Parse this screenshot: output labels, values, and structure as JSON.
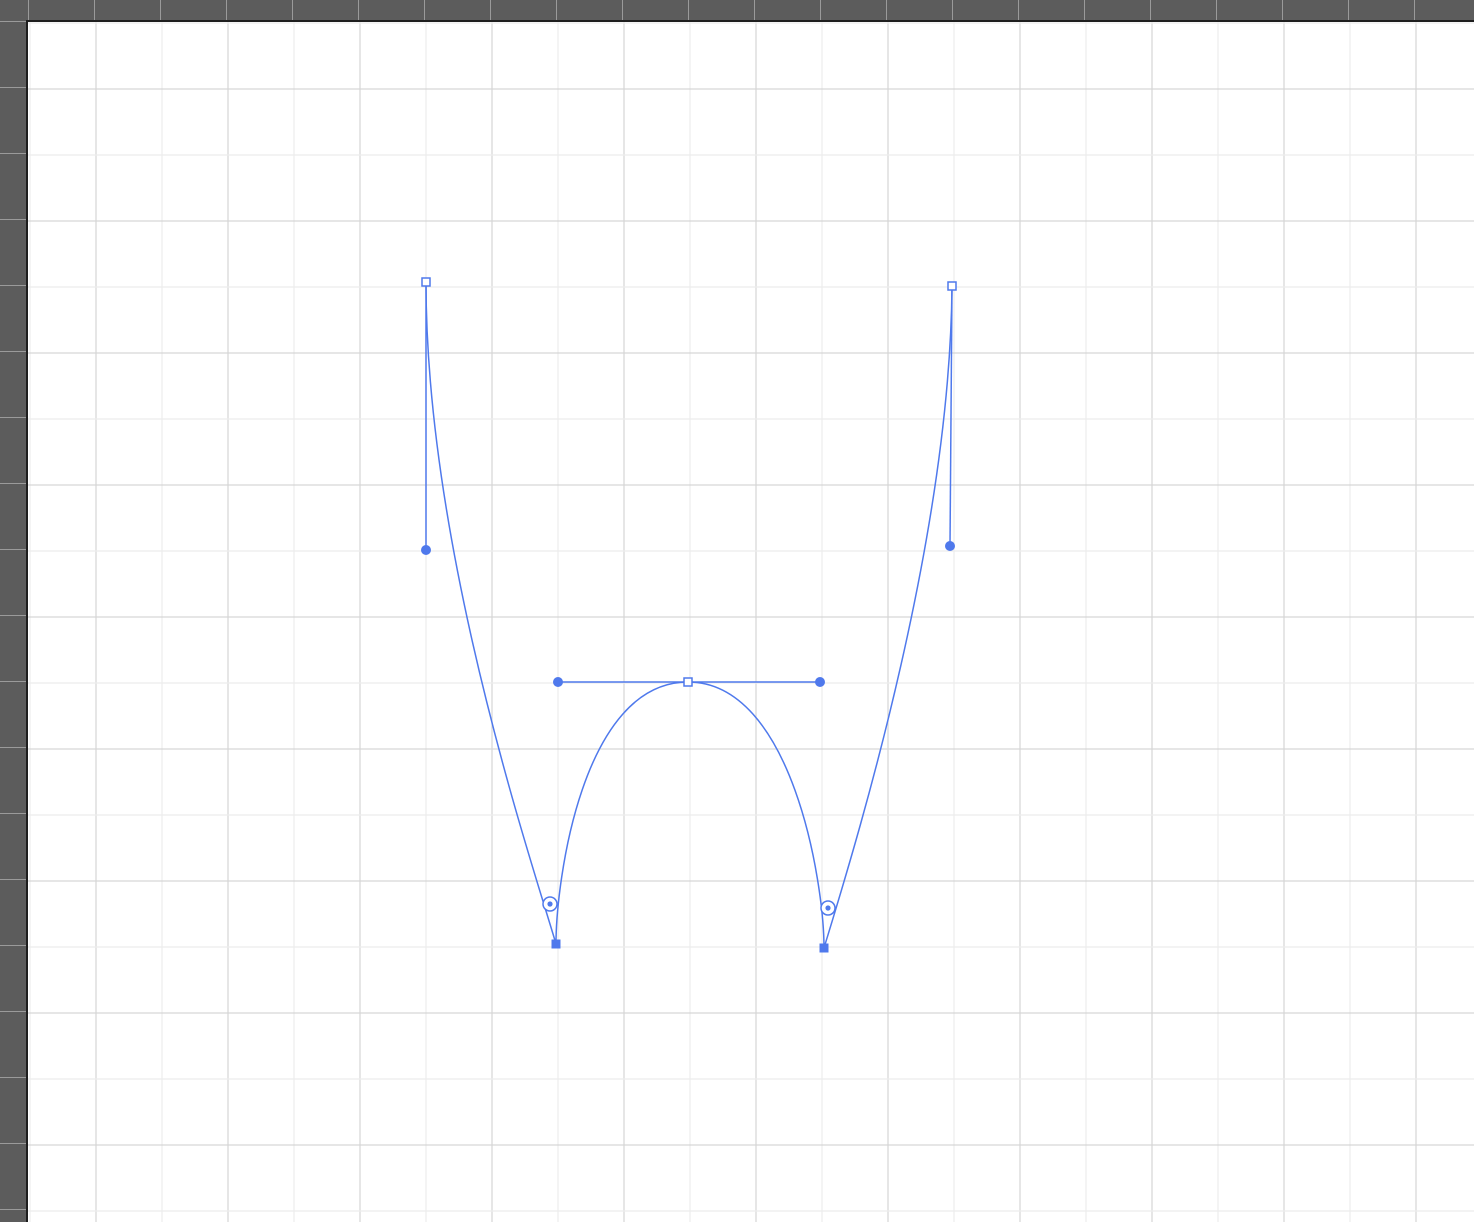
{
  "editor": {
    "accent_color": "#4f79ec",
    "canvas_background": "#ffffff",
    "grid_major_color": "#d6d6d6",
    "grid_minor_color": "#ececec",
    "ruler_color": "#5c5c5c",
    "tool_state": "pen-path-editing"
  },
  "path": {
    "name": "bezier-path",
    "anchors": [
      {
        "name": "anchor-top-left",
        "kind": "hollow-square",
        "selected": false
      },
      {
        "name": "anchor-bottom-left",
        "kind": "filled-square",
        "selected": true
      },
      {
        "name": "anchor-top-center",
        "kind": "hollow-square",
        "selected": false
      },
      {
        "name": "anchor-bottom-right",
        "kind": "filled-square",
        "selected": true
      },
      {
        "name": "anchor-top-right",
        "kind": "hollow-square",
        "selected": false
      }
    ],
    "handles": [
      {
        "name": "handle-left-down"
      },
      {
        "name": "handle-center-left"
      },
      {
        "name": "handle-center-right"
      },
      {
        "name": "handle-right-down"
      }
    ],
    "corner_widgets": [
      {
        "name": "corner-widget-left"
      },
      {
        "name": "corner-widget-right"
      }
    ]
  }
}
